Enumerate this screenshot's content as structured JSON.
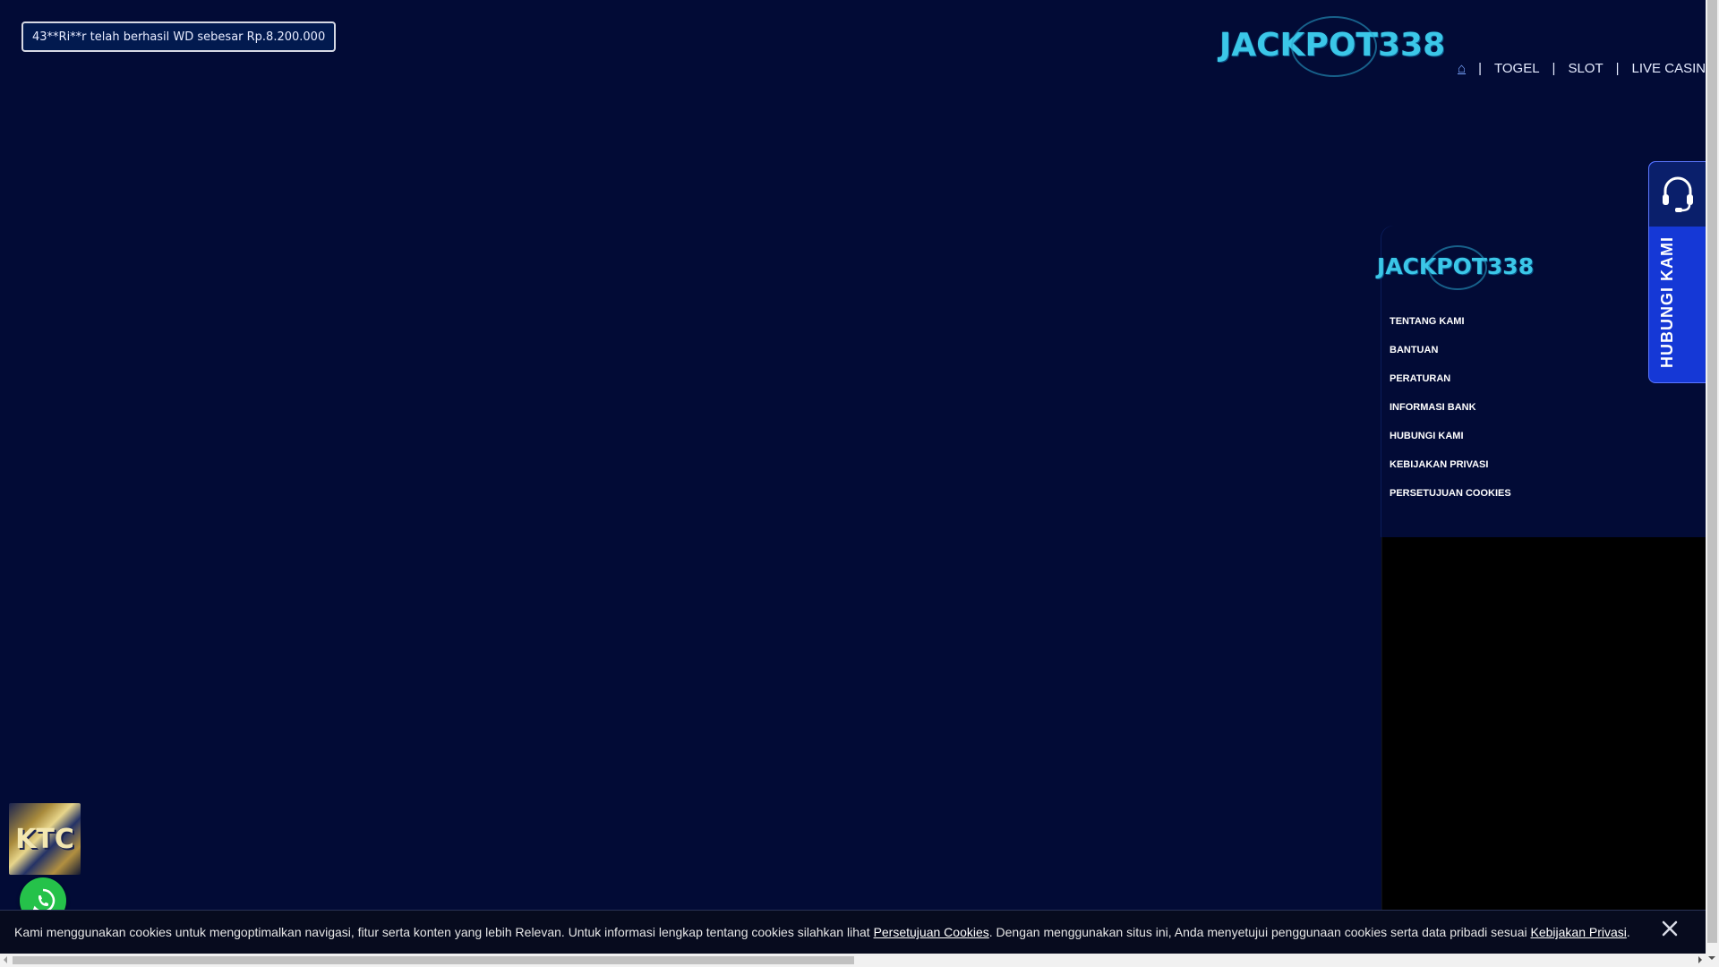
{
  "ticker": {
    "text": "43**Ri**r telah berhasil WD sebesar Rp.8.200.000"
  },
  "brand": {
    "logo_text": "JACKPOT338",
    "accent": "#3bc7e8",
    "bg": "#020b36"
  },
  "top_nav": {
    "home_icon": "home-icon",
    "items": [
      "TOGEL",
      "SLOT",
      "LIVE CASINO"
    ],
    "separator": "|"
  },
  "side_menu": {
    "items": [
      "TENTANG KAMI",
      "BANTUAN",
      "PERATURAN",
      "INFORMASI BANK",
      "HUBUNGI KAMI",
      "KEBIJAKAN PRIVASI",
      "PERSETUJUAN COOKIES"
    ]
  },
  "contact_tab": {
    "label": "HUBUNGI KAMI",
    "icon": "headset-icon",
    "color": "#1538d6"
  },
  "floating": {
    "game_thumb_text": "KTC",
    "whatsapp_icon": "whatsapp-icon",
    "whatsapp_color": "#25c24a"
  },
  "cookie_bar": {
    "text_1": "Kami menggunakan cookies untuk mengoptimalkan navigasi, fitur serta konten yang lebih Relevan. Untuk informasi lengkap tentang cookies silahkan lihat ",
    "link_1": "Persetujuan Cookies",
    "text_2": ". Dengan menggunakan situs ini, Anda menyetujui penggunaan cookies serta data pribadi sesuai ",
    "link_2": "Kebijakan Privasi",
    "text_3": ".",
    "close_icon": "close-icon"
  }
}
